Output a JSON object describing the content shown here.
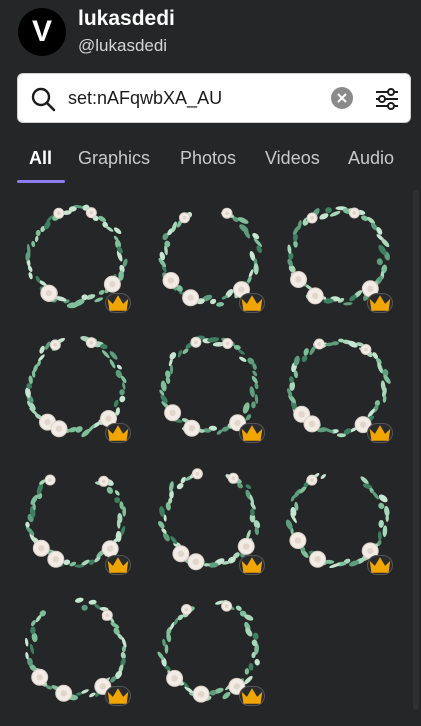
{
  "profile": {
    "avatar_letter": "V",
    "name": "lukasdedi",
    "handle": "@lukasdedi"
  },
  "search": {
    "value": "set:nAFqwbXA_AU",
    "icon": "search-icon",
    "clear_icon": "clear-icon",
    "filter_icon": "filter-icon"
  },
  "tabs": [
    {
      "label": "All",
      "active": true
    },
    {
      "label": "Graphics",
      "active": false
    },
    {
      "label": "Photos",
      "active": false
    },
    {
      "label": "Videos",
      "active": false
    },
    {
      "label": "Audio",
      "active": false
    }
  ],
  "colors": {
    "background": "#252627",
    "accent": "#8b7cf0",
    "crown": "#f0a500"
  },
  "results": [
    {
      "type": "floral-wreath",
      "premium": true
    },
    {
      "type": "floral-wreath",
      "premium": true
    },
    {
      "type": "floral-wreath",
      "premium": true
    },
    {
      "type": "floral-wreath",
      "premium": true
    },
    {
      "type": "floral-wreath",
      "premium": true
    },
    {
      "type": "floral-wreath",
      "premium": true
    },
    {
      "type": "floral-wreath",
      "premium": true
    },
    {
      "type": "floral-wreath",
      "premium": true
    },
    {
      "type": "floral-wreath",
      "premium": true
    },
    {
      "type": "floral-wreath",
      "premium": true
    },
    {
      "type": "floral-wreath",
      "premium": true
    }
  ]
}
